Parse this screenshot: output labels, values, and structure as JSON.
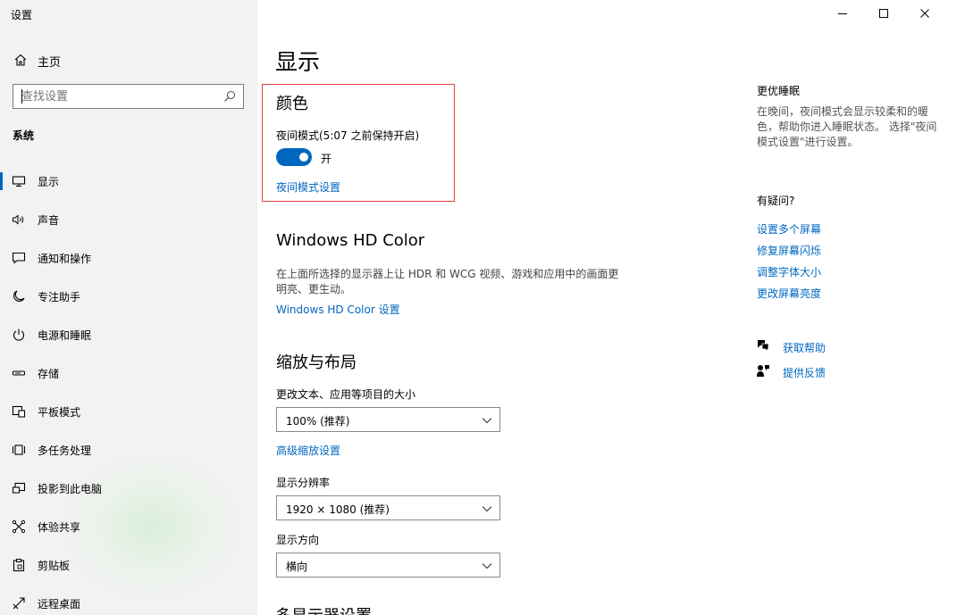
{
  "window": {
    "title": "设置",
    "controls": {
      "minimize": "minimize",
      "maximize": "maximize",
      "close": "close"
    }
  },
  "sidebar": {
    "home_label": "主页",
    "search_placeholder": "查找设置",
    "section": "系统",
    "items": [
      {
        "label": "显示",
        "icon": "monitor-icon",
        "active": true
      },
      {
        "label": "声音",
        "icon": "speaker-icon"
      },
      {
        "label": "通知和操作",
        "icon": "notification-icon"
      },
      {
        "label": "专注助手",
        "icon": "moon-icon"
      },
      {
        "label": "电源和睡眠",
        "icon": "power-icon"
      },
      {
        "label": "存储",
        "icon": "storage-icon"
      },
      {
        "label": "平板模式",
        "icon": "tablet-icon"
      },
      {
        "label": "多任务处理",
        "icon": "multitask-icon"
      },
      {
        "label": "投影到此电脑",
        "icon": "project-icon"
      },
      {
        "label": "体验共享",
        "icon": "share-icon"
      },
      {
        "label": "剪贴板",
        "icon": "clipboard-icon"
      },
      {
        "label": "远程桌面",
        "icon": "remote-icon"
      }
    ]
  },
  "main": {
    "title": "显示",
    "color": {
      "heading": "颜色",
      "night_light_label": "夜间模式(5:07 之前保持开启)",
      "toggle_state": "开",
      "toggle_on": true,
      "settings_link": "夜间模式设置"
    },
    "hd_color": {
      "heading": "Windows HD Color",
      "description_line1": "在上面所选择的显示器上让 HDR 和 WCG 视频、游戏和应用中的画面更",
      "description_line2": "明亮、更生动。",
      "link": "Windows HD Color 设置"
    },
    "scale": {
      "heading": "缩放与布局",
      "size_label": "更改文本、应用等项目的大小",
      "size_value": "100% (推荐)",
      "advanced_link": "高级缩放设置",
      "resolution_label": "显示分辨率",
      "resolution_value": "1920 × 1080 (推荐)",
      "orientation_label": "显示方向",
      "orientation_value": "横向"
    },
    "multi_display_heading": "多显示器设置"
  },
  "aside": {
    "sleep_heading": "更优睡眠",
    "sleep_desc_line1": "在晚间，夜间模式会显示较柔和的暖",
    "sleep_desc_line2": "色，帮助你进入睡眠状态。 选择\"夜间",
    "sleep_desc_line3": "模式设置\"进行设置。",
    "question_heading": "有疑问?",
    "links": [
      "设置多个屏幕",
      "修复屏幕闪烁",
      "调整字体大小",
      "更改屏幕亮度"
    ],
    "get_help": "获取帮助",
    "feedback": "提供反馈"
  },
  "colors": {
    "accent": "#0067c0",
    "highlight_border": "#e0443e",
    "sidebar_bg": "#f2f2f2"
  }
}
